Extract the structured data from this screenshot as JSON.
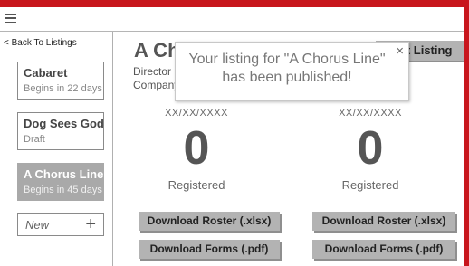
{
  "colors": {
    "frame": "#c8161d",
    "button_gray": "#b3b3b3",
    "selected_card": "#a9a9a9"
  },
  "topbar": {
    "menu_icon": "hamburger-icon"
  },
  "sidebar": {
    "back_label": "< Back To Listings",
    "listings": [
      {
        "title": "Cabaret",
        "subtitle": "Begins in 22 days"
      },
      {
        "title": "Dog Sees God",
        "subtitle": "Draft"
      },
      {
        "title": "A Chorus Line",
        "subtitle": "Begins in 45 days"
      }
    ],
    "new_label": "New",
    "new_icon": "plus-icon"
  },
  "main": {
    "title": "A Chorus Line",
    "director_label": "Director",
    "company_label": "Company",
    "edit_label": "Edit Listing",
    "columns": [
      {
        "date": "XX/XX/XXXX",
        "count": "0",
        "registered_label": "Registered",
        "roster_label": "Download Roster (.xlsx)",
        "forms_label": "Download Forms (.pdf)"
      },
      {
        "date": "XX/XX/XXXX",
        "count": "0",
        "registered_label": "Registered",
        "roster_label": "Download Roster (.xlsx)",
        "forms_label": "Download Forms (.pdf)"
      }
    ]
  },
  "toast": {
    "message": "Your listing for \"A Chorus Line\" has been published!",
    "close_label": "×"
  }
}
